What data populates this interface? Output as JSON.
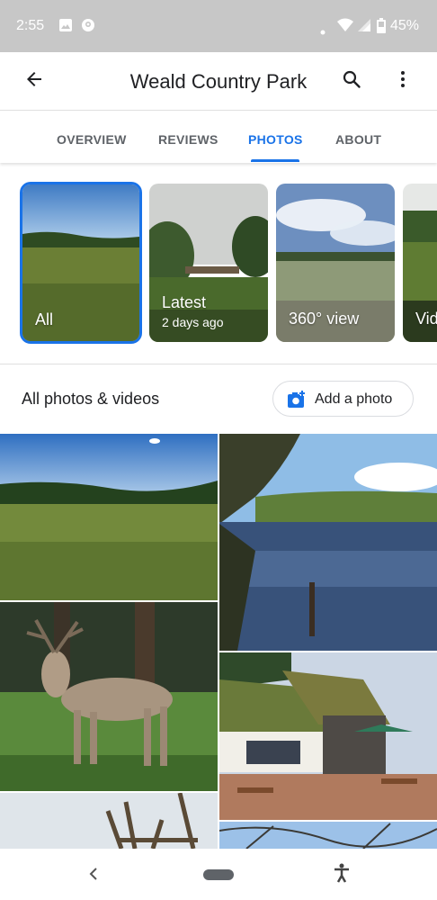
{
  "status_bar": {
    "time": "2:55",
    "battery_percent": "45%",
    "icons": [
      "image-icon",
      "location-pin-icon",
      "dot-icon",
      "wifi-icon",
      "cell-signal-icon",
      "battery-icon"
    ]
  },
  "app_bar": {
    "title": "Weald Country Park",
    "back_icon": "arrow-back-icon",
    "search_icon": "search-icon",
    "more_icon": "more-vert-icon"
  },
  "tabs": [
    {
      "label": "OVERVIEW",
      "active": false
    },
    {
      "label": "REVIEWS",
      "active": false
    },
    {
      "label": "PHOTOS",
      "active": true
    },
    {
      "label": "ABOUT",
      "active": false
    }
  ],
  "categories": [
    {
      "label": "All",
      "sub": "",
      "selected": true
    },
    {
      "label": "Latest",
      "sub": "2 days ago",
      "selected": false
    },
    {
      "label": "360° view",
      "sub": "",
      "selected": false
    },
    {
      "label": "Vid",
      "sub": "",
      "selected": false
    }
  ],
  "photos_section": {
    "title": "All photos & videos",
    "add_button_label": "Add a photo",
    "add_icon": "add-photo-camera-icon"
  },
  "photos": [
    {
      "name": "photo-meadow"
    },
    {
      "name": "photo-lake"
    },
    {
      "name": "photo-deer"
    },
    {
      "name": "photo-cafe"
    },
    {
      "name": "photo-wooden-structure"
    },
    {
      "name": "photo-branches"
    }
  ],
  "colors": {
    "accent": "#1a73e8",
    "status_bar_bg": "#c7c7c7",
    "text_primary": "#202124",
    "text_secondary": "#5f6368"
  },
  "nav_bar": {
    "back_icon": "nav-back-icon",
    "home_icon": "home-pill-icon",
    "accessibility_icon": "accessibility-icon"
  }
}
